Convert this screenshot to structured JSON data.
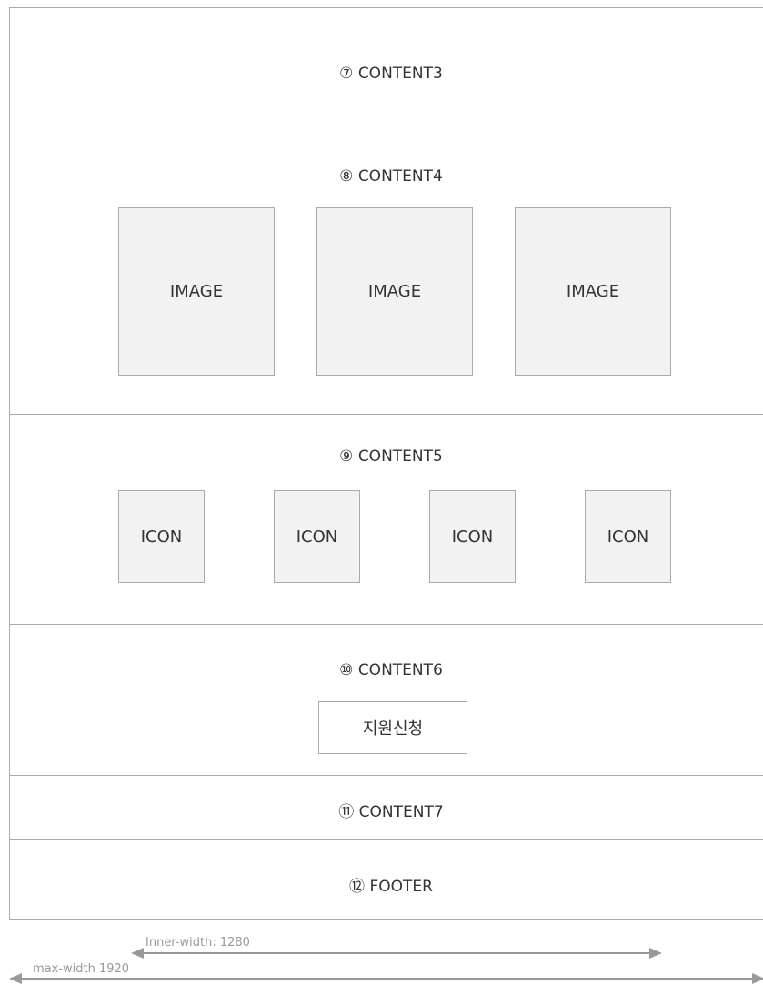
{
  "sections": {
    "content3": {
      "label": "⑦ CONTENT3"
    },
    "content4": {
      "label": "⑧ CONTENT4",
      "images": [
        "IMAGE",
        "IMAGE",
        "IMAGE"
      ]
    },
    "content5": {
      "label": "⑨ CONTENT5",
      "icons": [
        "ICON",
        "ICON",
        "ICON",
        "ICON"
      ]
    },
    "content6": {
      "label": "⑩ CONTENT6",
      "button_label": "지원신청"
    },
    "content7": {
      "label": "⑪ CONTENT7"
    },
    "footer": {
      "label": "⑫ FOOTER"
    }
  },
  "dimensions": {
    "inner_width_label": "Inner-width: 1280",
    "max_width_label": "max-width 1920"
  },
  "colors": {
    "border": "#aaaaaa",
    "box_fill": "#f2f2f2",
    "dimension": "#999999",
    "text": "#333333"
  }
}
